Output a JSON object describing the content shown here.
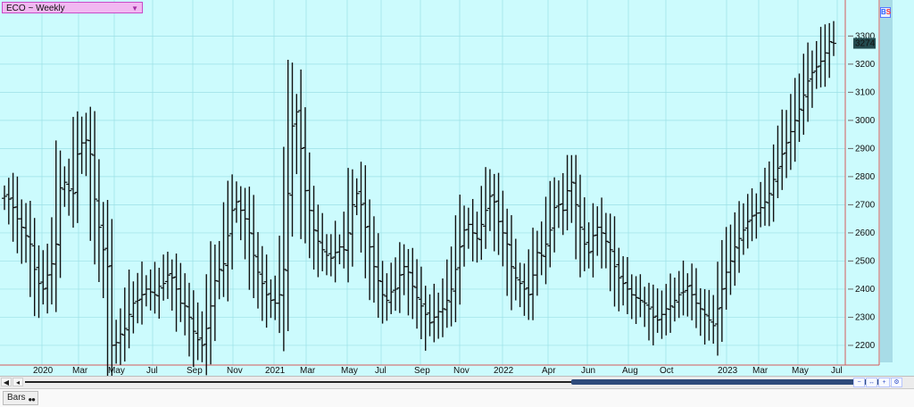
{
  "window": {
    "symbol_label": "ECO ~ Weekly"
  },
  "top_right_badge": {
    "left": "B",
    "right": "S"
  },
  "footer": {
    "bars_label": "Bars"
  },
  "price_badge": "3274",
  "icons": {
    "selector_caret": "triangle-down-icon",
    "scroll_left": "arrow-left-icon",
    "scroll_right": "arrow-right-icon",
    "bars_tab_icon": "toggle-icon"
  },
  "colors": {
    "chart_bg": "#ccfbfd",
    "grid": "#9be0e6",
    "axis": "#d35b5b",
    "bars": "#111111",
    "year_label": "#3050ff",
    "label_badge": "#244b4f"
  },
  "chart_data": {
    "type": "ohlc",
    "title": "ECO ~ Weekly",
    "xlabel": "",
    "ylabel": "",
    "y_range": [
      2130,
      3390
    ],
    "y_ticks": [
      2200,
      2300,
      2400,
      2500,
      2600,
      2700,
      2800,
      2900,
      3000,
      3100,
      3200,
      3300
    ],
    "x_labels": [
      {
        "label": "2020",
        "kind": "year"
      },
      {
        "label": "Mar",
        "kind": "month"
      },
      {
        "label": "May",
        "kind": "month"
      },
      {
        "label": "Jul",
        "kind": "month"
      },
      {
        "label": "Sep",
        "kind": "month"
      },
      {
        "label": "Nov",
        "kind": "month"
      },
      {
        "label": "2021",
        "kind": "year"
      },
      {
        "label": "Mar",
        "kind": "month"
      },
      {
        "label": "May",
        "kind": "month"
      },
      {
        "label": "Jul",
        "kind": "month"
      },
      {
        "label": "Sep",
        "kind": "month"
      },
      {
        "label": "Nov",
        "kind": "month"
      },
      {
        "label": "2022",
        "kind": "year"
      },
      {
        "label": "Apr",
        "kind": "month"
      },
      {
        "label": "Jun",
        "kind": "month"
      },
      {
        "label": "Aug",
        "kind": "month"
      },
      {
        "label": "Oct",
        "kind": "month"
      },
      {
        "label": "2023",
        "kind": "year"
      },
      {
        "label": "Mar",
        "kind": "month"
      },
      {
        "label": "May",
        "kind": "month"
      },
      {
        "label": "Jul",
        "kind": "month"
      }
    ],
    "grid": true,
    "last_price": 3274,
    "approx_weekly_closes": [
      2730,
      2720,
      2690,
      2650,
      2620,
      2590,
      2560,
      2470,
      2420,
      2400,
      2450,
      2490,
      2560,
      2760,
      2780,
      2750,
      2740,
      2880,
      2920,
      2930,
      2880,
      2720,
      2620,
      2540,
      2480,
      2200,
      2210,
      2240,
      2260,
      2310,
      2350,
      2360,
      2380,
      2400,
      2390,
      2380,
      2410,
      2420,
      2450,
      2440,
      2400,
      2350,
      2340,
      2300,
      2250,
      2220,
      2200,
      2260,
      2340,
      2430,
      2470,
      2490,
      2590,
      2680,
      2710,
      2680,
      2650,
      2600,
      2520,
      2460,
      2420,
      2380,
      2360,
      2350,
      2380,
      2470,
      2740,
      2980,
      3030,
      2900,
      2750,
      2680,
      2610,
      2570,
      2540,
      2520,
      2510,
      2530,
      2550,
      2540,
      2600,
      2700,
      2740,
      2700,
      2620,
      2550,
      2480,
      2430,
      2380,
      2360,
      2390,
      2400,
      2450,
      2480,
      2460,
      2410,
      2370,
      2340,
      2310,
      2280,
      2300,
      2320,
      2330,
      2360,
      2400,
      2470,
      2550,
      2610,
      2630,
      2600,
      2580,
      2630,
      2680,
      2730,
      2710,
      2640,
      2600,
      2560,
      2480,
      2440,
      2420,
      2400,
      2380,
      2450,
      2530,
      2520,
      2560,
      2610,
      2690,
      2700,
      2680,
      2750,
      2780,
      2700,
      2620,
      2560,
      2530,
      2590,
      2620,
      2600,
      2570,
      2540,
      2480,
      2440,
      2420,
      2400,
      2380,
      2370,
      2360,
      2350,
      2330,
      2300,
      2290,
      2310,
      2330,
      2340,
      2360,
      2380,
      2390,
      2410,
      2380,
      2350,
      2330,
      2310,
      2290,
      2270,
      2330,
      2400,
      2460,
      2500,
      2550,
      2580,
      2610,
      2640,
      2660,
      2670,
      2690,
      2710,
      2740,
      2790,
      2830,
      2880,
      2920,
      2960,
      3000,
      3040,
      3090,
      3140,
      3170,
      3190,
      3210,
      3240,
      3280,
      3274
    ]
  }
}
